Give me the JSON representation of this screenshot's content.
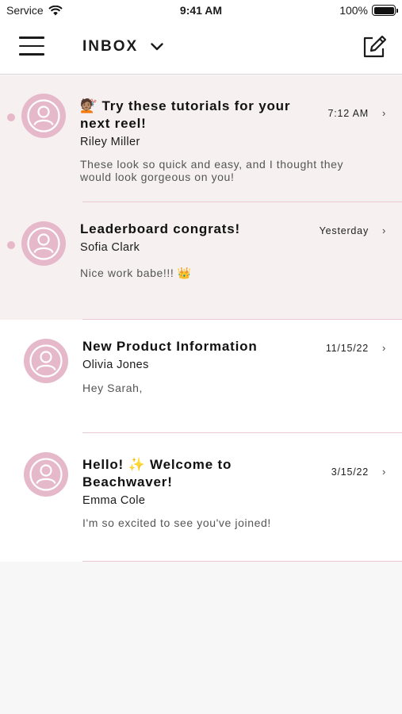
{
  "status_bar": {
    "carrier": "Service",
    "time": "9:41 AM",
    "battery": "100%"
  },
  "nav": {
    "title": "INBOX"
  },
  "messages": [
    {
      "subject": "💇🏽 Try these tutorials for your next reel!",
      "sender": "Riley Miller",
      "preview": "These look so quick and easy, and I thought they would look gorgeous on you!",
      "time": "7:12 AM",
      "unread": true
    },
    {
      "subject": "Leaderboard congrats!",
      "sender": "Sofia Clark",
      "preview": "Nice work babe!!! 👑",
      "time": "Yesterday",
      "unread": true
    },
    {
      "subject": "New Product Information",
      "sender": "Olivia Jones",
      "preview": "Hey Sarah,",
      "time": "11/15/22",
      "unread": false
    },
    {
      "subject": "Hello! ✨ Welcome to Beachwaver!",
      "sender": "Emma Cole",
      "preview": "I'm so excited to see you've joined!",
      "time": "3/15/22",
      "unread": false
    }
  ],
  "colors": {
    "accent_pink": "#e6b9ca",
    "unread_background": "#f6f0f0",
    "divider": "#ebc7d3"
  }
}
